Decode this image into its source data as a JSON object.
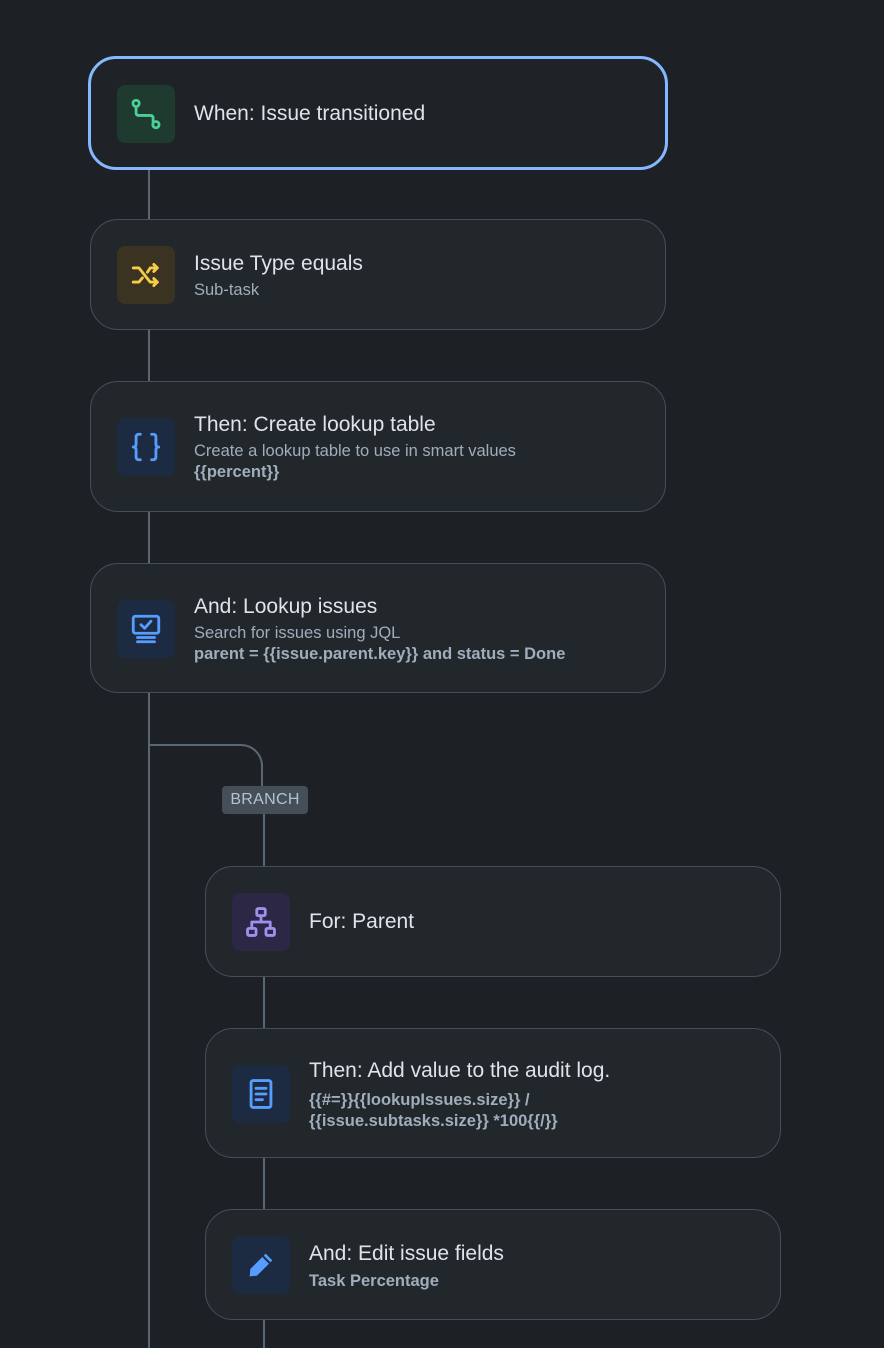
{
  "trigger": {
    "title": "When: Issue transitioned",
    "icon": "transition-icon",
    "color": "#4bce97"
  },
  "condition": {
    "title": "Issue Type equals",
    "subtitle": "Sub-task",
    "icon": "shuffle-icon",
    "color": "#f5cd47"
  },
  "steps": [
    {
      "title": "Then: Create lookup table",
      "subtitle": "Create a lookup table to use in smart values",
      "code": "{{percent}}",
      "icon": "curly-braces-icon",
      "color": "#579dff"
    },
    {
      "title": "And: Lookup issues",
      "subtitle": "Search for issues using JQL",
      "code": "parent = {{issue.parent.key}} and status = Done",
      "icon": "lookup-monitor-icon",
      "color": "#579dff"
    }
  ],
  "branch": {
    "label": "BRANCH",
    "for": {
      "title": "For: Parent",
      "icon": "hierarchy-icon",
      "color": "#9f8fef"
    },
    "steps": [
      {
        "title": "Then: Add value to the audit log.",
        "code_line1": "{{#=}}{{lookupIssues.size}} /",
        "code_line2": "{{issue.subtasks.size}} *100{{/}}",
        "icon": "document-icon",
        "color": "#579dff"
      },
      {
        "title": "And: Edit issue fields",
        "code": "Task Percentage",
        "icon": "pencil-icon",
        "color": "#579dff"
      }
    ]
  }
}
